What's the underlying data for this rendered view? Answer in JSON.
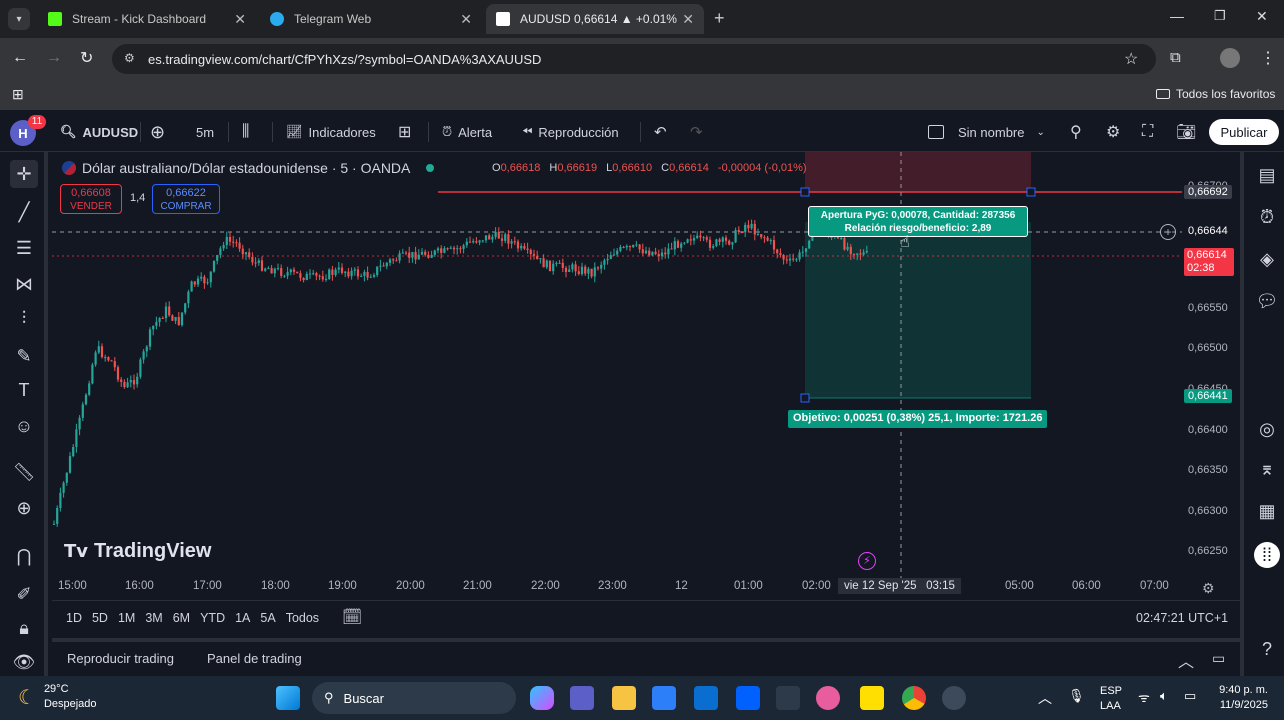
{
  "browser": {
    "tabs": [
      {
        "title": "Stream - Kick Dashboard",
        "color": "#53fc18"
      },
      {
        "title": "Telegram Web",
        "color": "#2aabee"
      },
      {
        "title": "AUDUSD 0,66614 ▲ +0.01% Si",
        "color": "#ffffff"
      }
    ],
    "url": "es.tradingview.com/chart/CfPYhXzs/?symbol=OANDA%3AXAUUSD",
    "bookmarks_label": "Todos los favoritos"
  },
  "toolbar": {
    "avatar_letter": "H",
    "notif_count": "11",
    "symbol": "AUDUSD",
    "interval": "5m",
    "indicators": "Indicadores",
    "alert": "Alerta",
    "replay": "Reproducción",
    "layout_name": "Sin nombre",
    "publish": "Publicar"
  },
  "legend": {
    "title": "Dólar australiano/Dólar estadounidense · 5 · OANDA",
    "o": "0,66618",
    "h": "0,66619",
    "l": "0,66610",
    "c": "0,66614",
    "change": "-0,00004 (-0,01%)",
    "sell_price": "0,66608",
    "sell_label": "VENDER",
    "spread": "1,4",
    "buy_price": "0,66622",
    "buy_label": "COMPRAR"
  },
  "position_tool": {
    "open_line1": "Apertura PyG: 0,00078, Cantidad: 287356",
    "open_line2": "Relación riesgo/beneficio: 2,89",
    "target": "Objetivo: 0,00251 (0,38%) 25,1, Importe: 1721.26"
  },
  "price_axis": {
    "labels": [
      "0,66550",
      "0,66500",
      "0,66450",
      "0,66400",
      "0,66350",
      "0,66300",
      "0,66250"
    ],
    "stop_badge": "0,66692",
    "cross_badge": "0,66644",
    "last_badge": "0,66614",
    "countdown": "02:38",
    "target_badge": "0,66441",
    "top_partial": "0,66700"
  },
  "time_axis": {
    "labels": [
      "15:00",
      "16:00",
      "17:00",
      "18:00",
      "19:00",
      "20:00",
      "21:00",
      "22:00",
      "23:00",
      "12",
      "01:00",
      "02:00",
      "05:00",
      "06:00",
      "07:00"
    ],
    "cursor_label": "vie 12 Sep '25   03:15"
  },
  "watermark": "TradingView",
  "ranges": [
    "1D",
    "5D",
    "1M",
    "3M",
    "6M",
    "YTD",
    "1A",
    "5A",
    "Todos"
  ],
  "clock": "02:47:21 UTC+1",
  "panels": {
    "replay": "Reproducir trading",
    "trading": "Panel de trading"
  },
  "taskbar": {
    "weather_temp": "29°C",
    "weather_desc": "Despejado",
    "search": "Buscar",
    "lang1": "ESP",
    "lang2": "LAA",
    "time": "9:40 p. m.",
    "date": "11/9/2025"
  },
  "colors": {
    "up": "#26a69a",
    "down": "#ef5350",
    "bg": "#131722",
    "accent": "#2962ff"
  }
}
